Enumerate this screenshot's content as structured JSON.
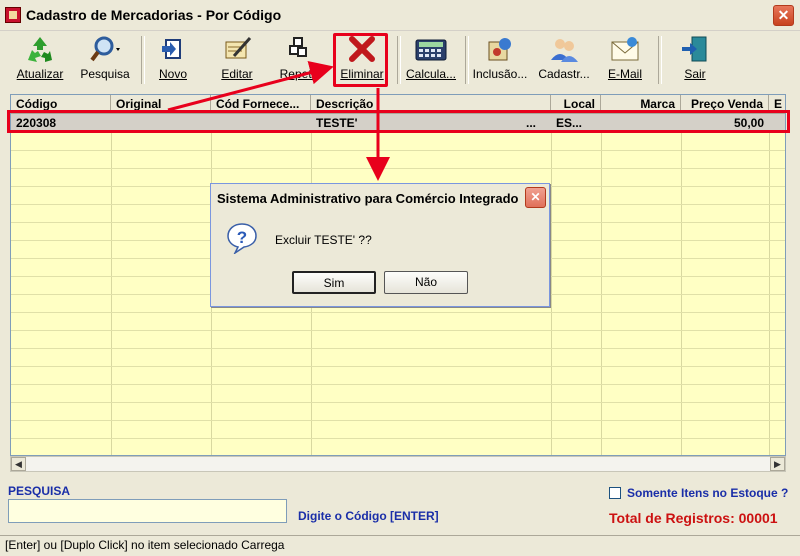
{
  "window": {
    "title": "Cadastro de Mercadorias - Por Código",
    "close_glyph": "✕"
  },
  "toolbar": {
    "buttons": [
      {
        "label": "Atualizar",
        "icon": "recycle-icon"
      },
      {
        "label": "Pesquisa",
        "icon": "magnifier-icon"
      },
      {
        "label": "Novo",
        "icon": "new-doc-icon"
      },
      {
        "label": "Editar",
        "icon": "edit-icon"
      },
      {
        "label": "Repete",
        "icon": "repeat-icon"
      },
      {
        "label": "Eliminar",
        "icon": "delete-x-icon"
      },
      {
        "label": "Calcula...",
        "icon": "calculator-icon"
      },
      {
        "label": "Inclusão...",
        "icon": "inclusion-icon"
      },
      {
        "label": "Cadastr...",
        "icon": "users-icon"
      },
      {
        "label": "E-Mail",
        "icon": "envelope-icon"
      },
      {
        "label": "Sair",
        "icon": "exit-door-icon"
      }
    ]
  },
  "grid": {
    "columns": [
      "Código",
      "Original",
      "Cód Fornece...",
      "Descrição",
      "Local",
      "Marca",
      "Preço Venda",
      "E"
    ],
    "row": {
      "codigo": "220308",
      "original": "",
      "cod_fornece": "",
      "descricao": "TESTE'",
      "descricao_more": "...",
      "local": "ES...",
      "marca": "",
      "preco_venda": "50,00"
    }
  },
  "search": {
    "label": "PESQUISA",
    "value": "",
    "hint": "Digite o Código [ENTER]"
  },
  "filter": {
    "checkbox_label": "Somente Itens no Estoque ?",
    "checked": false
  },
  "total": {
    "text": "Total de Registros: 00001"
  },
  "status": {
    "text": "[Enter] ou [Duplo Click] no item selecionado Carrega"
  },
  "dialog": {
    "title": "Sistema Administrativo para Comércio Integrado",
    "message": "Excluir TESTE' ??",
    "yes": "Sim",
    "no": "Não"
  },
  "colors": {
    "highlight": "#e8001c",
    "grid_bg": "#ffffc4",
    "label_blue": "#1a2ea8",
    "total_red": "#cc1111"
  }
}
